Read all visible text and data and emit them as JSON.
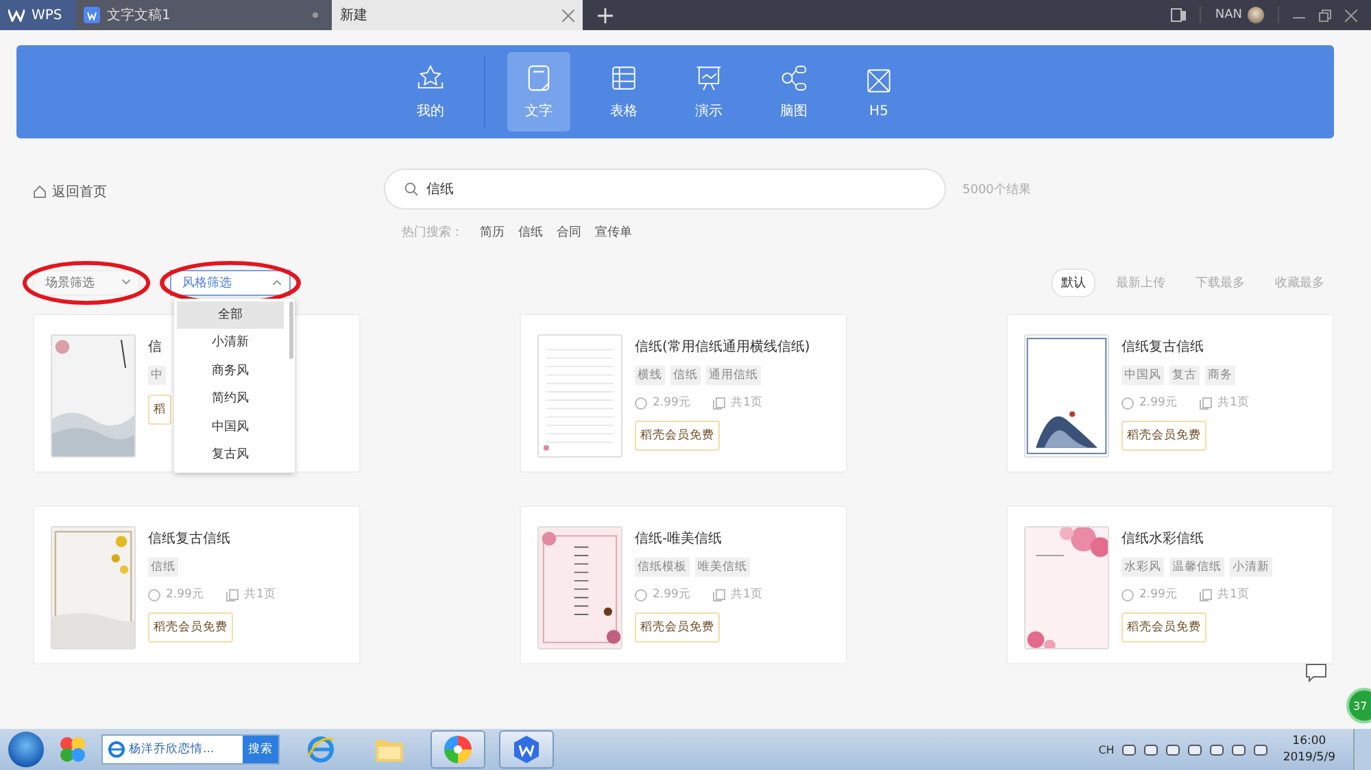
{
  "tabs": [
    {
      "kind": "logo",
      "label": "WPS",
      "selected": false
    },
    {
      "kind": "doc",
      "label": "文字文稿1",
      "selected": false
    },
    {
      "kind": "new",
      "label": "新建",
      "selected": true
    }
  ],
  "user": {
    "name": "NAN"
  },
  "categories": [
    {
      "label": "我的",
      "selected": false
    },
    {
      "label": "文字",
      "selected": true
    },
    {
      "label": "表格",
      "selected": false
    },
    {
      "label": "演示",
      "selected": false
    },
    {
      "label": "脑图",
      "selected": false
    },
    {
      "label": "H5",
      "selected": false
    }
  ],
  "back_link": "返回首页",
  "search": {
    "value": "信纸"
  },
  "result_count": "5000个结果",
  "hot_search": {
    "label": "热门搜索：",
    "items": [
      "简历",
      "信纸",
      "合同",
      "宣传单"
    ]
  },
  "filters": [
    {
      "label": "场景筛选",
      "expanded": false,
      "circled": true
    },
    {
      "label": "风格筛选",
      "expanded": true,
      "circled": true
    }
  ],
  "dropdown": {
    "items": [
      {
        "label": "全部",
        "selected": true
      },
      {
        "label": "小清新",
        "selected": false
      },
      {
        "label": "商务风",
        "selected": false
      },
      {
        "label": "简约风",
        "selected": false
      },
      {
        "label": "中国风",
        "selected": false
      },
      {
        "label": "复古风",
        "selected": false
      }
    ]
  },
  "sort_options": [
    {
      "label": "默认",
      "selected": true
    },
    {
      "label": "最新上传",
      "selected": false
    },
    {
      "label": "下载最多",
      "selected": false
    },
    {
      "label": "收藏最多",
      "selected": false
    }
  ],
  "templates": [
    {
      "title": "信",
      "tags": [
        "中"
      ],
      "badge": "稻"
    },
    {
      "title": "信纸(常用信纸通用横线信纸)",
      "tags": [
        "横线",
        "信纸",
        "通用信纸"
      ],
      "price": "2.99元",
      "pages": "共1页",
      "badge": "稻壳会员免费"
    },
    {
      "title": "信纸复古信纸",
      "tags": [
        "中国风",
        "复古",
        "商务"
      ],
      "price": "2.99元",
      "pages": "共1页",
      "badge": "稻壳会员免费"
    },
    {
      "title": "信纸复古信纸",
      "tags": [
        "信纸"
      ],
      "price": "2.99元",
      "pages": "共1页",
      "badge": "稻壳会员免费"
    },
    {
      "title": "信纸-唯美信纸",
      "tags": [
        "信纸模板",
        "唯美信纸"
      ],
      "price": "2.99元",
      "pages": "共1页",
      "badge": "稻壳会员免费"
    },
    {
      "title": "信纸水彩信纸",
      "tags": [
        "水彩风",
        "温馨信纸",
        "小清新"
      ],
      "price": "2.99元",
      "pages": "共1页",
      "badge": "稻壳会员免费"
    }
  ],
  "floating_badge": "37",
  "taskbar": {
    "search": {
      "value": "杨洋乔欣恋情...",
      "button": "搜索"
    },
    "apps": [
      {
        "selected": false
      },
      {
        "selected": false
      },
      {
        "selected": true
      },
      {
        "selected": true
      }
    ],
    "language": "CH",
    "time": "16:00",
    "date": "2019/5/9"
  }
}
